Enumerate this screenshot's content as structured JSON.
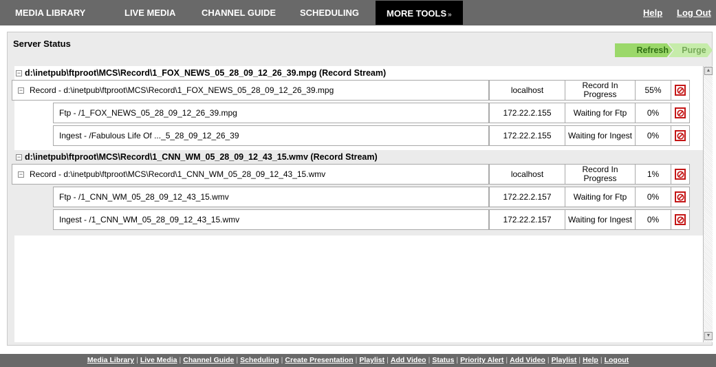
{
  "topnav": {
    "items": [
      "MEDIA LIBRARY",
      "LIVE MEDIA",
      "CHANNEL GUIDE",
      "SCHEDULING"
    ],
    "active": "MORE TOOLS",
    "active_icon": "double-chevron-down-icon",
    "right_links": [
      "Help",
      "Log Out"
    ]
  },
  "panel": {
    "title": "Server Status",
    "refresh_label": "Refresh",
    "purge_label": "Purge"
  },
  "colors": {
    "nav_bg": "#696969",
    "active_tab": "#000000",
    "refresh_bg": "#9bd86a",
    "purge_bg": "#c6ecaa",
    "cancel_red": "#c41616"
  },
  "groups": [
    {
      "header": "d:\\inetpub\\ftproot\\MCS\\Record\\1_FOX_NEWS_05_28_09_12_26_39.mpg (Record Stream)",
      "rows": [
        {
          "name": "Record - d:\\inetpub\\ftproot\\MCS\\Record\\1_FOX_NEWS_05_28_09_12_26_39.mpg",
          "host": "localhost",
          "status": "Record In Progress",
          "percent": "55%"
        },
        {
          "name": "Ftp - /1_FOX_NEWS_05_28_09_12_26_39.mpg",
          "host": "172.22.2.155",
          "status": "Waiting for Ftp",
          "percent": "0%"
        },
        {
          "name": "Ingest - /Fabulous Life Of ..._5_28_09_12_26_39",
          "host": "172.22.2.155",
          "status": "Waiting for Ingest",
          "percent": "0%"
        }
      ]
    },
    {
      "header": "d:\\inetpub\\ftproot\\MCS\\Record\\1_CNN_WM_05_28_09_12_43_15.wmv (Record Stream)",
      "rows": [
        {
          "name": "Record - d:\\inetpub\\ftproot\\MCS\\Record\\1_CNN_WM_05_28_09_12_43_15.wmv",
          "host": "localhost",
          "status": "Record In Progress",
          "percent": "1%"
        },
        {
          "name": "Ftp - /1_CNN_WM_05_28_09_12_43_15.wmv",
          "host": "172.22.2.157",
          "status": "Waiting for Ftp",
          "percent": "0%"
        },
        {
          "name": "Ingest - /1_CNN_WM_05_28_09_12_43_15.wmv",
          "host": "172.22.2.157",
          "status": "Waiting for Ingest",
          "percent": "0%"
        }
      ]
    }
  ],
  "expander_glyph": "⊟",
  "scrollbar": {
    "up": "▲",
    "down": "▼"
  },
  "footer": {
    "links": [
      "Media Library",
      "Live Media",
      "Channel Guide",
      "Scheduling",
      "Create Presentation",
      "Playlist",
      "Add Video",
      "Status",
      "Priority Alert",
      "Add Video",
      "Playlist",
      "Help",
      "Logout"
    ],
    "separator": "|"
  }
}
